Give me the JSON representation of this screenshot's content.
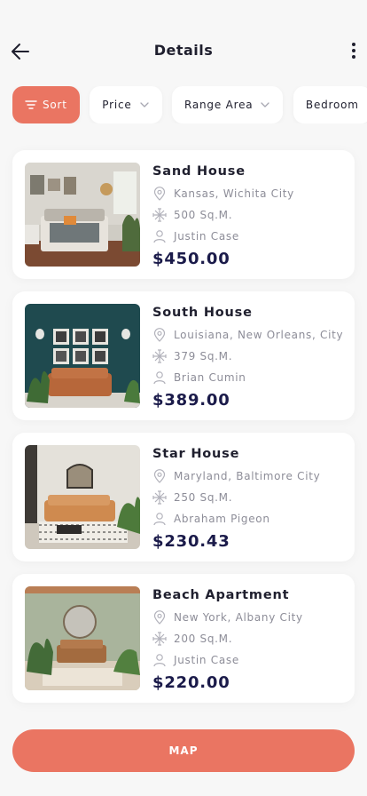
{
  "header": {
    "title": "Details"
  },
  "filters": [
    {
      "label": "Sort",
      "active": true
    },
    {
      "label": "Price",
      "active": false
    },
    {
      "label": "Range Area",
      "active": false
    },
    {
      "label": "Bedroom",
      "active": false
    }
  ],
  "listings": [
    {
      "name": "Sand House",
      "location": "Kansas, Wichita City",
      "area": "500 Sq.M.",
      "agent": "Justin Case",
      "price": "$450.00"
    },
    {
      "name": "South House",
      "location": "Louisiana, New Orleans, City",
      "area": "379 Sq.M.",
      "agent": "Brian Cumin",
      "price": "$389.00"
    },
    {
      "name": "Star House",
      "location": "Maryland, Baltimore City",
      "area": "250 Sq.M.",
      "agent": "Abraham Pigeon",
      "price": "$230.43"
    },
    {
      "name": "Beach Apartment",
      "location": "New York, Albany City",
      "area": "200 Sq.M.",
      "agent": "Justin Case",
      "price": "$220.00"
    }
  ],
  "map_button": {
    "label": "MAP"
  },
  "colors": {
    "accent": "#ea7562",
    "price": "#1b1b4a",
    "muted": "#8d8d98"
  },
  "icons": [
    "back-arrow-icon",
    "more-vertical-icon",
    "sort-icon",
    "chevron-down-icon",
    "location-pin-icon",
    "area-icon",
    "user-icon"
  ]
}
